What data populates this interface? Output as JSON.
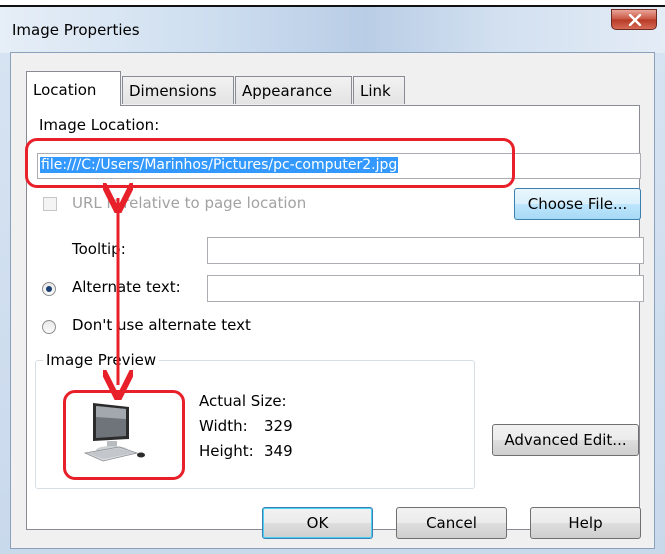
{
  "window": {
    "title": "Image Properties",
    "close_glyph": "x"
  },
  "tabs": [
    {
      "label": "Location",
      "active": true
    },
    {
      "label": "Dimensions",
      "active": false
    },
    {
      "label": "Appearance",
      "active": false
    },
    {
      "label": "Link",
      "active": false
    }
  ],
  "location": {
    "image_location_label": "Image Location:",
    "image_location_value": "file:///C:/Users/Marinhos/Pictures/pc-computer2.jpg",
    "url_relative_label": "URL is relative to page location",
    "url_relative_checked": false,
    "url_relative_enabled": false,
    "choose_file_button": "Choose File...",
    "tooltip_label": "Tooltip:",
    "tooltip_value": "",
    "alternate_text_label": "Alternate text:",
    "alternate_text_selected": true,
    "alternate_text_value": "",
    "dont_use_alt_label": "Don't use alternate text",
    "dont_use_alt_selected": false
  },
  "preview": {
    "group_label": "Image Preview",
    "actual_size_label": "Actual Size:",
    "width_label": "Width:",
    "width_value": "329",
    "height_label": "Height:",
    "height_value": "349",
    "image_icon": "computer-monitor-icon"
  },
  "buttons": {
    "advanced_edit": "Advanced Edit...",
    "ok": "OK",
    "cancel": "Cancel",
    "help": "Help"
  },
  "annotation_color": "#e8202a"
}
